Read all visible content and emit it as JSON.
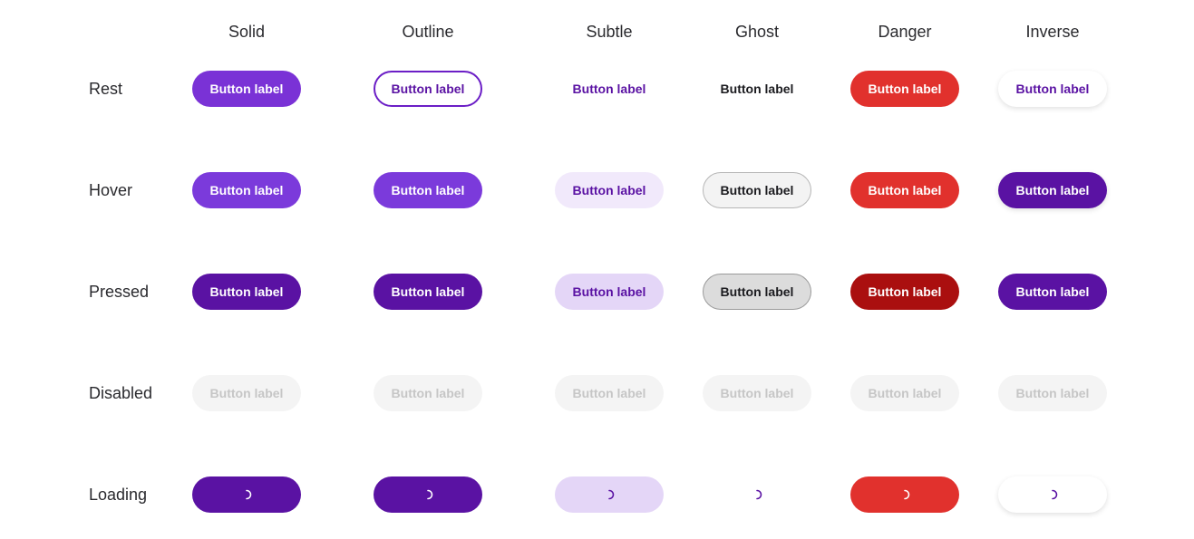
{
  "columns": [
    "Solid",
    "Outline",
    "Subtle",
    "Ghost",
    "Danger",
    "Inverse"
  ],
  "rows": [
    "Rest",
    "Hover",
    "Pressed",
    "Disabled",
    "Loading"
  ],
  "button_label": "Button label",
  "colors": {
    "primary": "#7a32d6",
    "primary_pressed": "#5a12a3",
    "subtle_hover": "#f1e9fb",
    "subtle_pressed": "#e4d6f7",
    "danger": "#e1312d",
    "danger_pressed": "#aa0f0f",
    "disabled_bg": "#f4f4f4",
    "disabled_text": "#c6c6c6"
  },
  "icons": {
    "loading": "spinner-icon"
  }
}
